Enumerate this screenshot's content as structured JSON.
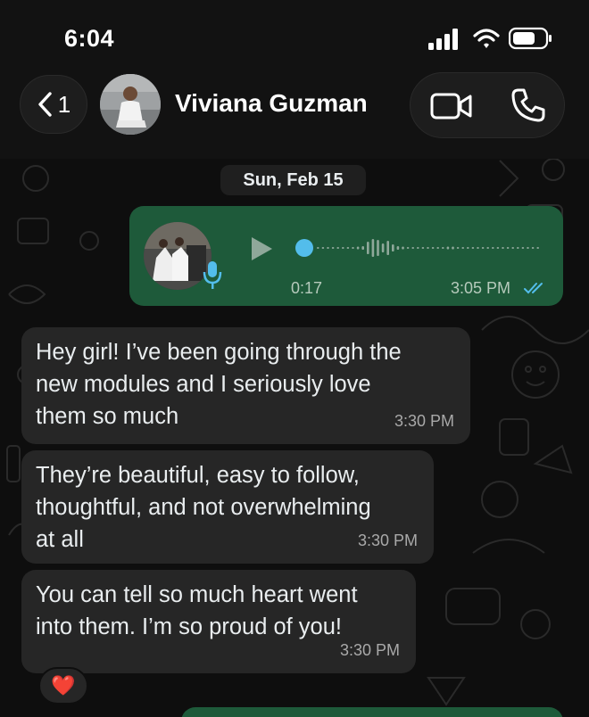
{
  "status_bar": {
    "time": "6:04",
    "signal_icon": "cellular-signal-icon",
    "wifi_icon": "wifi-icon",
    "battery_icon": "battery-icon"
  },
  "header": {
    "back_count": "1",
    "contact_name": "Viviana Guzman",
    "video_icon": "video-camera-icon",
    "phone_icon": "phone-icon"
  },
  "date_chip": "Sun, Feb 15",
  "voice_message": {
    "duration": "0:17",
    "time": "3:05 PM",
    "status": "read",
    "tick_color": "#53bdeb"
  },
  "messages": [
    {
      "text": "Hey girl! I’ve been going through the\nnew modules and I seriously love\nthem so much",
      "time": "3:30 PM"
    },
    {
      "text": "They’re beautiful, easy to follow,\nthoughtful, and not overwhelming\nat all",
      "time": "3:30 PM"
    },
    {
      "text": "You can tell so much heart went\ninto them. I’m so proud of you!",
      "time": "3:30 PM"
    }
  ],
  "reaction": {
    "icon": "heart-reaction-icon",
    "glyph": "❤️"
  },
  "colors": {
    "outgoing_bubble": "#1e5a3a",
    "incoming_bubble": "#262626",
    "background": "#0e0e0e",
    "header": "#121212"
  }
}
